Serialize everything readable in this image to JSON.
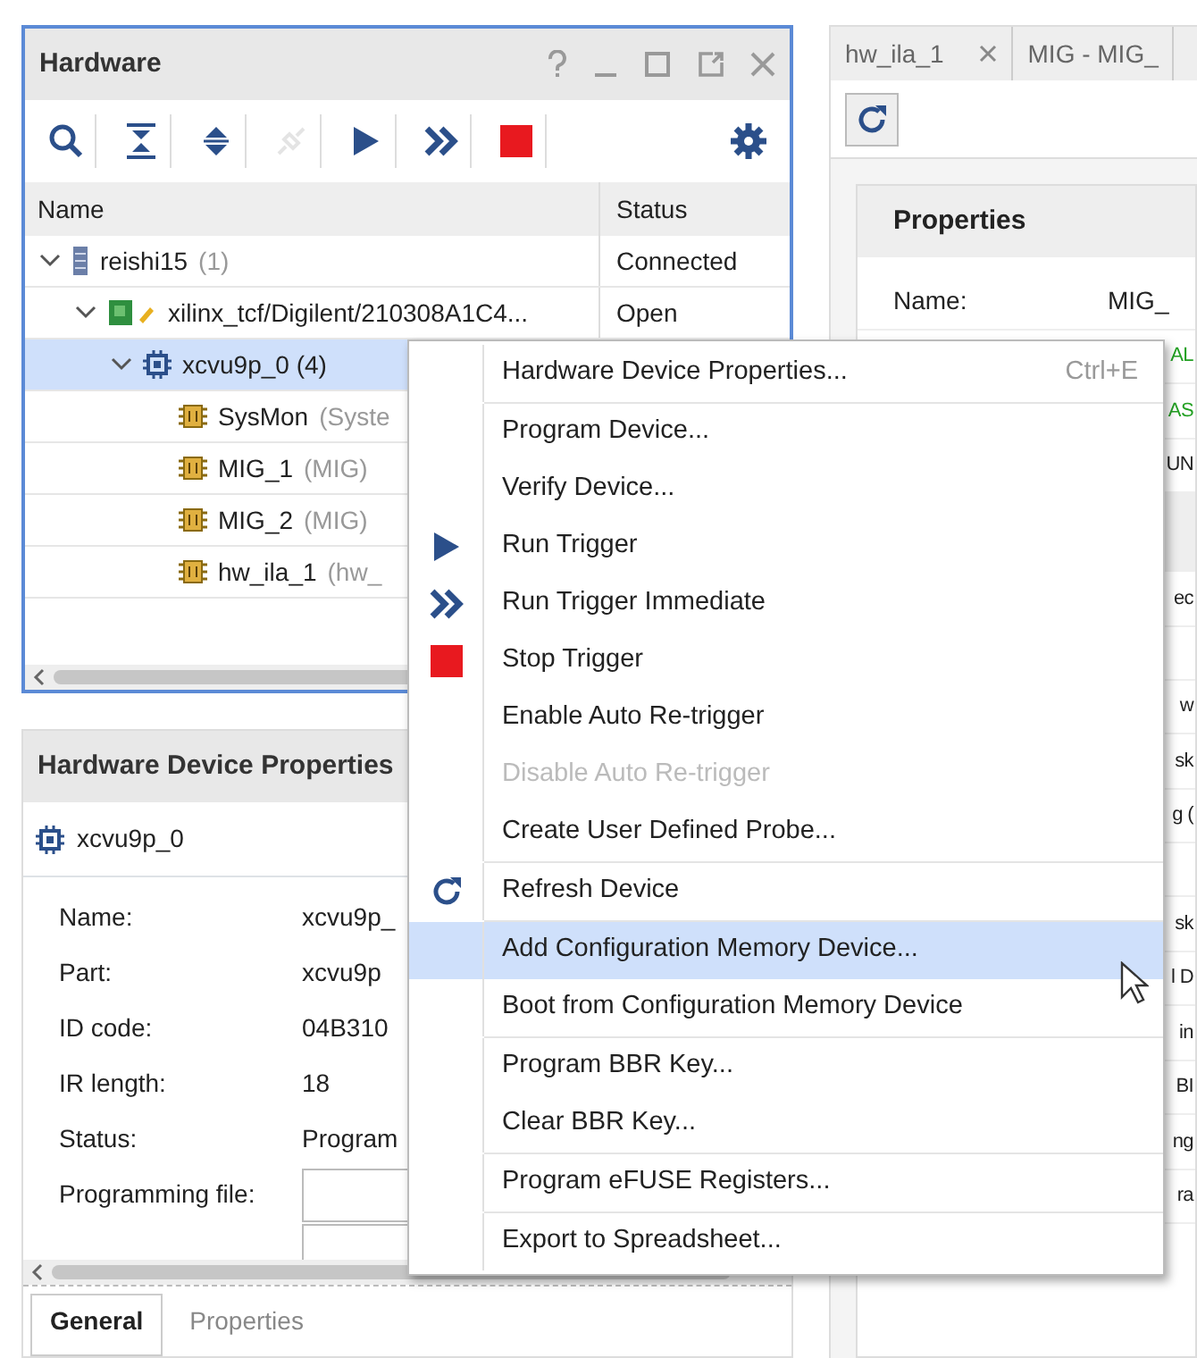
{
  "hardware": {
    "title": "Hardware",
    "toolbar": [
      {
        "kind": "search",
        "disabled": false
      },
      {
        "kind": "collapse",
        "disabled": false
      },
      {
        "kind": "expand",
        "disabled": false
      },
      {
        "kind": "connect",
        "disabled": true
      },
      {
        "kind": "run",
        "disabled": false
      },
      {
        "kind": "run-immediate",
        "disabled": false
      },
      {
        "kind": "stop",
        "disabled": false
      }
    ],
    "columns": [
      "Name",
      "Status"
    ],
    "tree": [
      {
        "kind": "server",
        "name": "reishi15",
        "suffix": "(1)",
        "status": "Connected",
        "selected": false,
        "expanded": true,
        "children": [
          {
            "kind": "target",
            "name": "xilinx_tcf/Digilent/210308A1C4...",
            "status": "Open",
            "selected": false,
            "expanded": true,
            "children": [
              {
                "kind": "device",
                "name": "xcvu9p_0 (4)",
                "selected": true,
                "expanded": true,
                "children": [
                  {
                    "kind": "core",
                    "name": "SysMon",
                    "suffix": "(Syste",
                    "selected": false
                  },
                  {
                    "kind": "core",
                    "name": "MIG_1",
                    "suffix": "(MIG)",
                    "selected": false
                  },
                  {
                    "kind": "core",
                    "name": "MIG_2",
                    "suffix": "(MIG)",
                    "selected": false
                  },
                  {
                    "kind": "core",
                    "name": "hw_ila_1",
                    "suffix": "(hw_",
                    "selected": false
                  }
                ]
              }
            ]
          }
        ]
      }
    ]
  },
  "device_properties": {
    "title": "Hardware Device Properties",
    "device": "xcvu9p_0",
    "rows": [
      {
        "label": "Name:",
        "value": "xcvu9p_"
      },
      {
        "label": "Part:",
        "value": "xcvu9p"
      },
      {
        "label": "ID code:",
        "value": "04B310"
      },
      {
        "label": "IR length:",
        "value": "18"
      },
      {
        "label": "Status:",
        "value": "Program"
      },
      {
        "label": "Programming file:",
        "kind": "field"
      }
    ],
    "tabs": [
      {
        "label": "General",
        "selected": true
      },
      {
        "label": "Properties",
        "selected": false
      }
    ]
  },
  "editor": {
    "tabs": [
      {
        "label": "hw_ila_1",
        "closable": true,
        "selected": false
      },
      {
        "label": "MIG - MIG_",
        "closable": false,
        "selected": false
      }
    ],
    "properties_title": "Properties",
    "sections": [
      [
        {
          "label": "Name:",
          "value": "MIG_"
        },
        {
          "value": "AL",
          "color": "#22a022"
        },
        {
          "value": "AS",
          "color": "#22a022"
        },
        {
          "value": "UN",
          "color": "#222222"
        }
      ],
      [
        {
          "value": "ec",
          "color": "#222222"
        }
      ],
      [
        {
          "value": "w",
          "color": "#222222"
        },
        {
          "value": "sk",
          "color": "#222222"
        },
        {
          "value": "g (",
          "color": "#222222"
        }
      ],
      [
        {
          "value": "sk",
          "color": "#222222"
        },
        {
          "value": "l D",
          "color": "#222222"
        },
        {
          "value": "in",
          "color": "#222222"
        },
        {
          "value": "BI",
          "color": "#222222"
        },
        {
          "value": "ng",
          "color": "#222222"
        },
        {
          "value": "ra",
          "color": "#222222"
        }
      ]
    ]
  },
  "context_menu": {
    "groups": [
      [
        {
          "label": "Hardware Device Properties...",
          "shortcut": "Ctrl+E",
          "disabled": false,
          "highlighted": false
        }
      ],
      [
        {
          "label": "Program Device...",
          "disabled": false,
          "highlighted": false
        },
        {
          "label": "Verify Device...",
          "disabled": false,
          "highlighted": false
        },
        {
          "label": "Run Trigger",
          "kind": "run",
          "disabled": false,
          "highlighted": false
        },
        {
          "label": "Run Trigger Immediate",
          "kind": "run-immediate",
          "disabled": false,
          "highlighted": false
        },
        {
          "label": "Stop Trigger",
          "kind": "stop",
          "disabled": false,
          "highlighted": false
        },
        {
          "label": "Enable Auto Re-trigger",
          "disabled": false,
          "highlighted": false
        },
        {
          "label": "Disable Auto Re-trigger",
          "disabled": true,
          "highlighted": false
        },
        {
          "label": "Create User Defined Probe...",
          "disabled": false,
          "highlighted": false
        }
      ],
      [
        {
          "label": "Refresh Device",
          "kind": "refresh",
          "disabled": false,
          "highlighted": false
        }
      ],
      [
        {
          "label": "Add Configuration Memory Device...",
          "disabled": false,
          "highlighted": true
        },
        {
          "label": "Boot from Configuration Memory Device",
          "disabled": false,
          "highlighted": false
        }
      ],
      [
        {
          "label": "Program BBR Key...",
          "disabled": false,
          "highlighted": false
        },
        {
          "label": "Clear BBR Key...",
          "disabled": false,
          "highlighted": false
        }
      ],
      [
        {
          "label": "Program eFUSE Registers...",
          "disabled": false,
          "highlighted": false
        }
      ],
      [
        {
          "label": "Export to Spreadsheet...",
          "disabled": false,
          "highlighted": false
        }
      ]
    ]
  }
}
